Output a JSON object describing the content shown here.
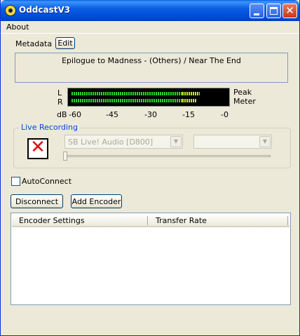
{
  "window": {
    "title": "OddcastV3",
    "close_glyph": "✕"
  },
  "menu": {
    "items": [
      {
        "label": "About"
      }
    ]
  },
  "metadata": {
    "label": "Metadata",
    "edit_button": "Edit",
    "current_text": "Epilogue to Madness - (Others) / Near The End"
  },
  "meter": {
    "left_channel_label": "L",
    "right_channel_label": "R",
    "unit_label": "dB",
    "scale_labels": [
      "-60",
      "-45",
      "-30",
      "-15",
      "-0"
    ],
    "peak_label": "Peak",
    "meter_label": "Meter",
    "left_level_fraction": 0.83,
    "right_level_fraction": 0.81,
    "green_color": "#2bd42b",
    "yellow_color": "#c8e820"
  },
  "live_recording": {
    "group_label": "Live Recording",
    "device_select_value": "SB Live! Audio [D800]",
    "secondary_select_value": "",
    "status_icon": "record-disabled-icon",
    "volume_fraction": 0.0
  },
  "autoconnect": {
    "label": "AutoConnect",
    "checked": false
  },
  "actions": {
    "disconnect_button": "Disconnect",
    "add_encoder_button": "Add Encoder"
  },
  "encoder_list": {
    "columns": [
      "Encoder Settings",
      "Transfer Rate"
    ],
    "rows": []
  },
  "colors": {
    "title_bar": "#0a5fe0",
    "window_bg": "#ece9d8",
    "group_title": "#0046d5",
    "close_button": "#c8371a"
  }
}
